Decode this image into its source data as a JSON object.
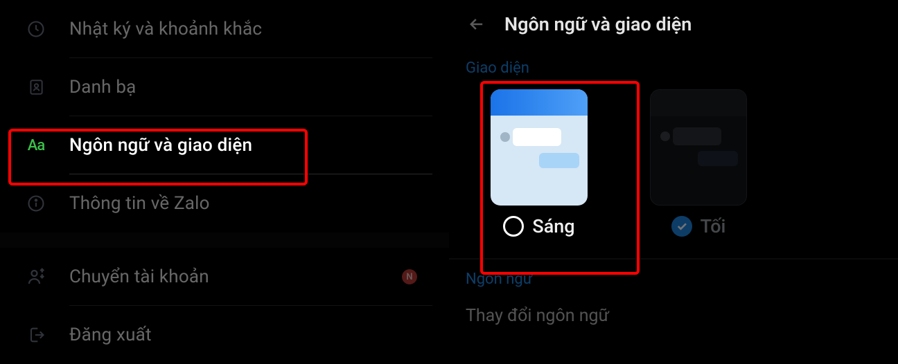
{
  "left": {
    "items": [
      {
        "label": "Nhật ký và khoảnh khắc"
      },
      {
        "label": "Danh bạ"
      },
      {
        "label": "Ngôn ngữ và giao diện"
      },
      {
        "label": "Thông tin về Zalo"
      },
      {
        "label": "Chuyển tài khoản",
        "badge": "N"
      },
      {
        "label": "Đăng xuất"
      }
    ]
  },
  "right": {
    "title": "Ngôn ngữ và giao diện",
    "section_theme": "Giao diện",
    "theme_light": "Sáng",
    "theme_dark": "Tối",
    "section_lang": "Ngôn ngữ",
    "change_lang": "Thay đổi ngôn ngữ"
  }
}
